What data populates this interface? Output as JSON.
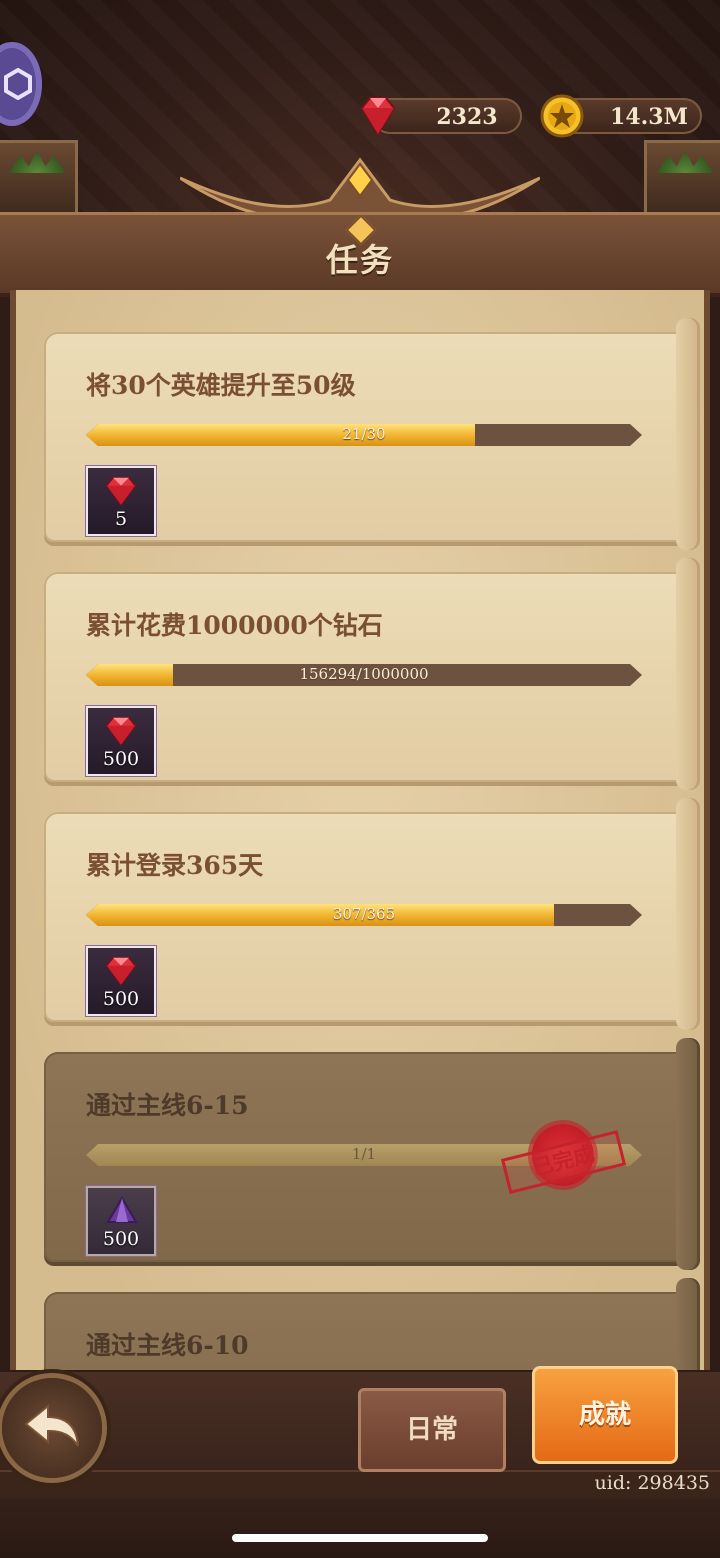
{
  "currencies": {
    "gems": {
      "value": "2323",
      "icon": "ruby-gem-icon"
    },
    "gold": {
      "value": "14.3M",
      "icon": "gold-coin-icon"
    }
  },
  "header": {
    "title": "任务"
  },
  "tasks": [
    {
      "name": "将30个英雄提升至50级",
      "progress_text": "21/30",
      "progress": 0.7,
      "reward_qty": "5",
      "reward_icon": "ruby-gem-icon",
      "done": false
    },
    {
      "name": "累计花费1000000个钻石",
      "progress_text": "156294/1000000",
      "progress": 0.156,
      "reward_qty": "500",
      "reward_icon": "ruby-gem-icon",
      "done": false
    },
    {
      "name": "累计登录365天",
      "progress_text": "307/365",
      "progress": 0.841,
      "reward_qty": "500",
      "reward_icon": "ruby-gem-icon",
      "done": false
    },
    {
      "name": "通过主线6-15",
      "progress_text": "1/1",
      "progress": 1.0,
      "reward_qty": "500",
      "reward_icon": "purple-crystal-icon",
      "done": true,
      "stamp": "已完成"
    },
    {
      "name": "通过主线6-10",
      "done": true
    }
  ],
  "tabs": {
    "daily": "日常",
    "achievement": "成就"
  },
  "footer": {
    "uid": "uid: 298435"
  },
  "colors": {
    "accent": "#e46a16",
    "progress": "#f0b22c",
    "stamp": "#c4232d"
  }
}
